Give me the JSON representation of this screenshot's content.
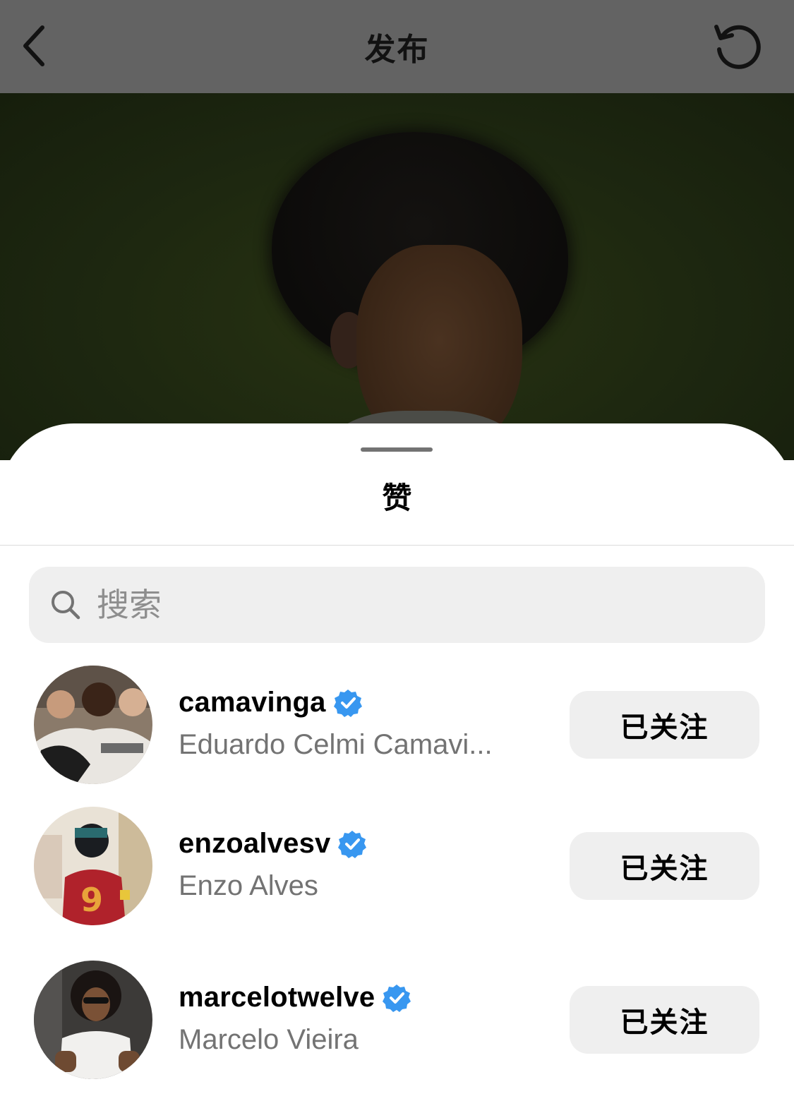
{
  "nav": {
    "title": "发布",
    "back_icon": "chevron-left-icon",
    "refresh_icon": "refresh-icon"
  },
  "sheet": {
    "title": "赞",
    "search": {
      "placeholder": "搜索",
      "icon": "search-icon"
    }
  },
  "likers": [
    {
      "username": "camavinga",
      "full_name": "Eduardo Celmi Camavi...",
      "verified": true,
      "button_label": "已关注"
    },
    {
      "username": "enzoalvesv",
      "full_name": "Enzo Alves",
      "verified": true,
      "button_label": "已关注"
    },
    {
      "username": "marcelotwelve",
      "full_name": "Marcelo Vieira",
      "verified": true,
      "button_label": "已关注"
    }
  ],
  "colors": {
    "verified_badge": "#3897f0",
    "secondary_text": "#737373",
    "button_bg": "#efefef",
    "overlay_bar": "#636363"
  }
}
